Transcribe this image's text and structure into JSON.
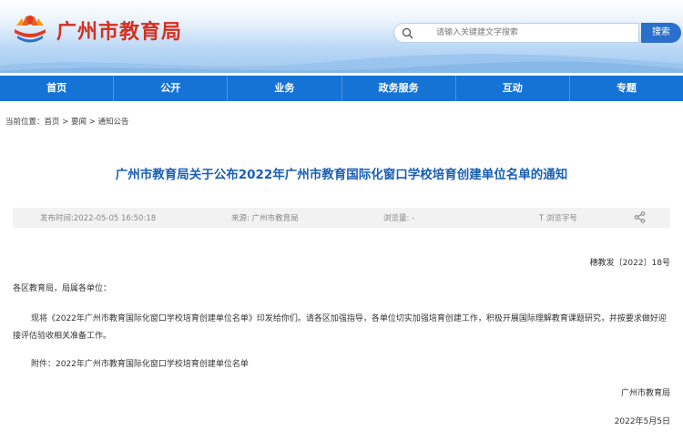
{
  "header": {
    "site_title": "广州市教育局",
    "search_placeholder": "请输入关键建文字搜索",
    "search_button": "搜索"
  },
  "nav": {
    "items": [
      {
        "label": "首页"
      },
      {
        "label": "公开"
      },
      {
        "label": "业务"
      },
      {
        "label": "政务服务"
      },
      {
        "label": "互动"
      },
      {
        "label": "专题"
      }
    ]
  },
  "breadcrumb": "当前位置：首页 > 要闻 > 通知公告",
  "article": {
    "title": "广州市教育局关于公布2022年广州市教育国际化窗口学校培育创建单位名单的通知",
    "meta": {
      "publish_time": "发布时间:2022-05-05 16:50:18",
      "source": "来源: 广州市教育局",
      "views": "浏览量: -",
      "font_size_label": "T  浏览字号"
    },
    "doc_number": "穗教发〔2022〕18号",
    "salutation": "各区教育局，局属各单位：",
    "paragraph": "现将《2022年广州市教育国际化窗口学校培育创建单位名单》印发给你们。请各区加强指导，各单位切实加强培育创建工作，积极开展国际理解教育课题研究，并按要求做好迎接评估验收相关准备工作。",
    "attachment": "附件：2022年广州市教育国际化窗口学校培育创建单位名单",
    "signer": "广州市教育局",
    "date": "2022年5月5日"
  },
  "colors": {
    "brand_red": "#d3301f",
    "nav_blue": "#1673d6",
    "title_blue": "#1a5fb4"
  }
}
